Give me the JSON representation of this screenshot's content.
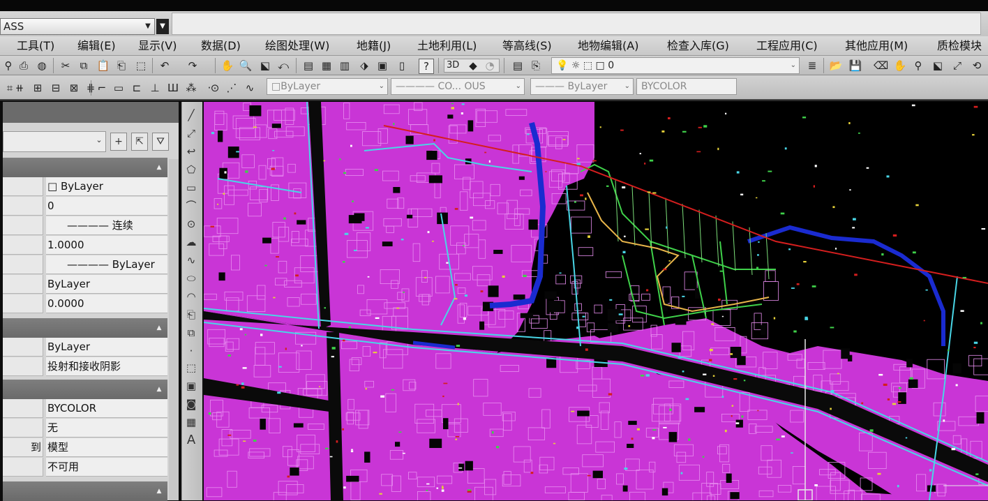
{
  "app": {
    "title_fragment": "ASS"
  },
  "menu": {
    "items": [
      "工具(T)",
      "编辑(E)",
      "显示(V)",
      "数据(D)",
      "绘图处理(W)",
      "地籍(J)",
      "土地利用(L)",
      "等高线(S)",
      "地物编辑(A)",
      "检查入库(G)",
      "工程应用(C)",
      "其他应用(M)",
      "质检模块"
    ]
  },
  "toolbar": {
    "view3d_label": "3D",
    "layer_value": "0",
    "color_combo": "□ByLayer",
    "linetype_combo": "———— CO... OUS",
    "lineweight_combo": "——— ByLayer",
    "plotstyle_combo": "BYCOLOR"
  },
  "palette": {
    "sections": [
      {
        "rows": [
          {
            "name": "",
            "value": "□ ByLayer"
          },
          {
            "name": "",
            "value": "0"
          },
          {
            "name": "",
            "value": "———— 连续"
          },
          {
            "name": "",
            "value": "1.0000"
          },
          {
            "name": "",
            "value": "———— ByLayer"
          },
          {
            "name": "",
            "value": "ByLayer"
          },
          {
            "name": "",
            "value": "0.0000"
          }
        ]
      },
      {
        "rows": [
          {
            "name": "",
            "value": "ByLayer"
          },
          {
            "name": "",
            "value": "投射和接收阴影"
          }
        ]
      },
      {
        "rows": [
          {
            "name": "",
            "value": "BYCOLOR"
          },
          {
            "name": "",
            "value": "无"
          },
          {
            "name": "到",
            "value": "模型"
          },
          {
            "name": "",
            "value": "不可用"
          }
        ]
      }
    ]
  },
  "drawbar": {
    "text_tool_label": "A"
  },
  "colors": {
    "parcel": "#c935d6",
    "parcel_line": "#e88ef0",
    "road": "#101010",
    "river": "#1a2bd0",
    "cyan": "#49d6e6",
    "green": "#3fd14a",
    "boundary": "#d41e1e",
    "yellow": "#e6d23a",
    "orange": "#e8b54a"
  }
}
